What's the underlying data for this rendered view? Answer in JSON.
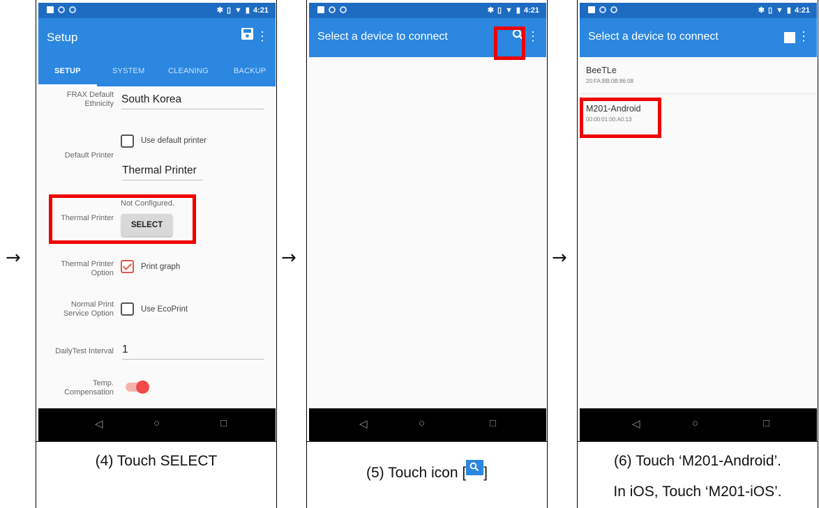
{
  "panels": [
    {
      "status": {
        "time": "4:21"
      },
      "appbar": {
        "title": "Setup"
      },
      "tabs": [
        "SETUP",
        "SYSTEM",
        "CLEANING",
        "BACKUP"
      ],
      "fields": {
        "frax_label_1": "FRAX Default",
        "frax_label_2": "Ethnicity",
        "frax_value": "South Korea",
        "default_printer_label": "Default Printer",
        "use_default_printer": "Use default printer",
        "default_printer_value": "Thermal Printer",
        "not_configured": "Not Configured.",
        "thermal_printer_label": "Thermal Printer",
        "select_button": "SELECT",
        "tp_option_label_1": "Thermal Printer",
        "tp_option_label_2": "Option",
        "print_graph": "Print graph",
        "normal_print_label_1": "Normal Print",
        "normal_print_label_2": "Service Option",
        "use_ecoprint": "Use EcoPrint",
        "dailytest_label": "DailyTest Interval",
        "dailytest_value": "1",
        "temp_label_1": "Temp.",
        "temp_label_2": "Compensation"
      },
      "caption": "(4) Touch SELECT"
    },
    {
      "status": {
        "time": "4:21"
      },
      "appbar": {
        "title": "Select a device to connect"
      },
      "caption_prefix": "(5) Touch icon [",
      "caption_suffix": "]"
    },
    {
      "status": {
        "time": "4:21"
      },
      "appbar": {
        "title": "Select a device to connect"
      },
      "devices": [
        {
          "name": "BeeTLe",
          "address": "20:FA:BB:0B:86:08"
        },
        {
          "name": "M201-Android",
          "address": "00:00:01:00:A0:13"
        }
      ],
      "caption_line1": "(6) Touch ‘M201-Android’.",
      "caption_line2": "In iOS, Touch ‘M201-iOS’."
    }
  ],
  "arrow": "→",
  "navbar": {
    "back": "◁",
    "home": "○",
    "recents": "□"
  },
  "colors": {
    "appbar": "#2b87e0",
    "statusbar": "#1e6bc2",
    "highlight": "#ee0000",
    "toggle": "#f04a4a"
  }
}
